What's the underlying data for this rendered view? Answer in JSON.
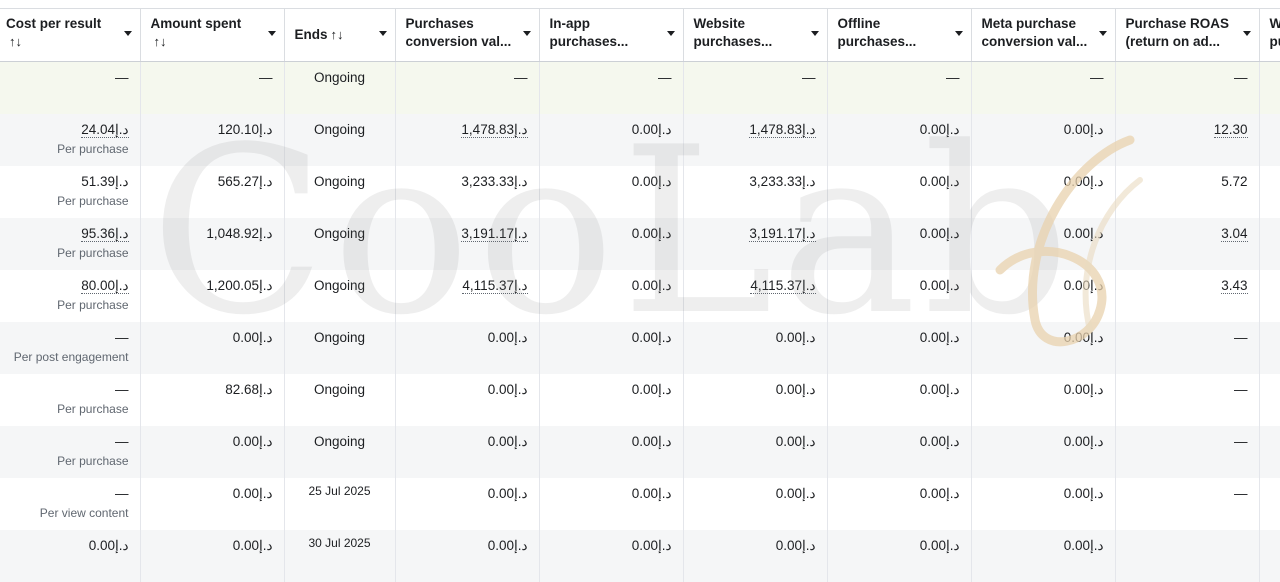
{
  "columns": [
    {
      "label1": "Cost per result",
      "label2": "",
      "sort_glyph": "↑↓"
    },
    {
      "label1": "Amount spent",
      "label2": "",
      "sort_glyph": "↑↓"
    },
    {
      "label1": "Ends",
      "label2": "",
      "sort_glyph": "↑↓"
    },
    {
      "label1": "Purchases",
      "label2": "conversion val...",
      "sort_glyph": ""
    },
    {
      "label1": "In-app",
      "label2": "purchases...",
      "sort_glyph": ""
    },
    {
      "label1": "Website",
      "label2": "purchases...",
      "sort_glyph": ""
    },
    {
      "label1": "Offline",
      "label2": "purchases...",
      "sort_glyph": ""
    },
    {
      "label1": "Meta purchase",
      "label2": "conversion val...",
      "sort_glyph": ""
    },
    {
      "label1": "Purchase ROAS",
      "label2": "(return on ad...",
      "sort_glyph": ""
    },
    {
      "label1": "W",
      "label2": "pu",
      "sort_glyph": ""
    }
  ],
  "summary": [
    "—",
    "—",
    "Ongoing",
    "—",
    "—",
    "—",
    "—",
    "—",
    "—",
    ""
  ],
  "rows": [
    {
      "cost": "24.04د.إ",
      "cost_sub": "Per purchase",
      "spent": "120.10د.إ",
      "ends": "Ongoing",
      "pcv": "1,478.83د.إ",
      "inapp": "0.00د.إ",
      "web": "1,478.83د.إ",
      "offline": "0.00د.إ",
      "meta": "0.00د.إ",
      "roas": "12.30",
      "w": ""
    },
    {
      "cost": "51.39د.إ",
      "cost_sub": "Per purchase",
      "spent": "565.27د.إ",
      "ends": "Ongoing",
      "pcv": "3,233.33د.إ",
      "inapp": "0.00د.إ",
      "web": "3,233.33د.إ",
      "offline": "0.00د.إ",
      "meta": "0.00د.إ",
      "roas": "5.72",
      "w": ""
    },
    {
      "cost": "95.36د.إ",
      "cost_sub": "Per purchase",
      "spent": "1,048.92د.إ",
      "ends": "Ongoing",
      "pcv": "3,191.17د.إ",
      "inapp": "0.00د.إ",
      "web": "3,191.17د.إ",
      "offline": "0.00د.إ",
      "meta": "0.00د.إ",
      "roas": "3.04",
      "w": ""
    },
    {
      "cost": "80.00د.إ",
      "cost_sub": "Per purchase",
      "spent": "1,200.05د.إ",
      "ends": "Ongoing",
      "pcv": "4,115.37د.إ",
      "inapp": "0.00د.إ",
      "web": "4,115.37د.إ",
      "offline": "0.00د.إ",
      "meta": "0.00د.إ",
      "roas": "3.43",
      "w": ""
    },
    {
      "cost": "—",
      "cost_sub": "Per post engagement",
      "spent": "0.00د.إ",
      "ends": "Ongoing",
      "pcv": "0.00د.إ",
      "inapp": "0.00د.إ",
      "web": "0.00د.إ",
      "offline": "0.00د.إ",
      "meta": "0.00د.إ",
      "roas": "—",
      "w": ""
    },
    {
      "cost": "—",
      "cost_sub": "Per purchase",
      "spent": "82.68د.إ",
      "ends": "Ongoing",
      "pcv": "0.00د.إ",
      "inapp": "0.00د.إ",
      "web": "0.00د.إ",
      "offline": "0.00د.إ",
      "meta": "0.00د.إ",
      "roas": "—",
      "w": ""
    },
    {
      "cost": "—",
      "cost_sub": "Per purchase",
      "spent": "0.00د.إ",
      "ends": "Ongoing",
      "pcv": "0.00د.إ",
      "inapp": "0.00د.إ",
      "web": "0.00د.إ",
      "offline": "0.00د.إ",
      "meta": "0.00د.إ",
      "roas": "—",
      "w": ""
    },
    {
      "cost": "—",
      "cost_sub": "Per view content",
      "spent": "0.00د.إ",
      "ends": "25 Jul 2025",
      "pcv": "0.00د.إ",
      "inapp": "0.00د.إ",
      "web": "0.00د.إ",
      "offline": "0.00د.إ",
      "meta": "0.00د.إ",
      "roas": "—",
      "w": ""
    },
    {
      "cost": "0.00د.إ",
      "cost_sub": "",
      "spent": "0.00د.إ",
      "ends": "30 Jul 2025",
      "pcv": "0.00د.إ",
      "inapp": "0.00د.إ",
      "web": "0.00د.إ",
      "offline": "0.00د.إ",
      "meta": "0.00د.إ",
      "roas": "",
      "w": ""
    }
  ],
  "watermark": {
    "text": "CooLab"
  },
  "colors": {
    "summary_bg": "#f5f8ee",
    "alt_row_bg": "#f5f6f7",
    "border": "#dadde1",
    "subtext": "#606770"
  }
}
